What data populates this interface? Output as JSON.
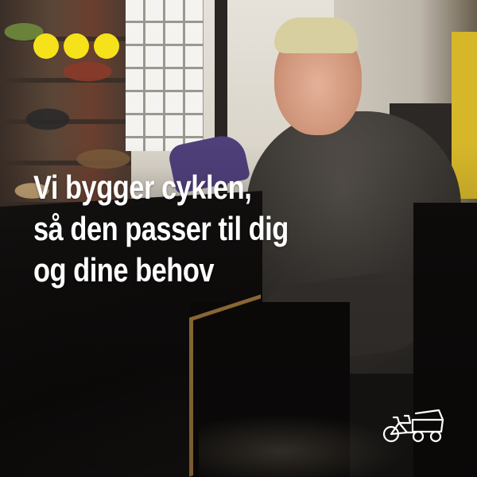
{
  "headline": {
    "lines": [
      "Vi bygger cyklen,",
      "så den passer til dig",
      "og dine behov"
    ]
  },
  "dots": {
    "count": 3,
    "color": "#f6e21a"
  },
  "logo": {
    "icon": "cargo-bike-icon",
    "color": "#ffffff"
  },
  "colors": {
    "text": "#ffffff",
    "accent": "#f6e21a",
    "box_edge": "#b98a47"
  }
}
